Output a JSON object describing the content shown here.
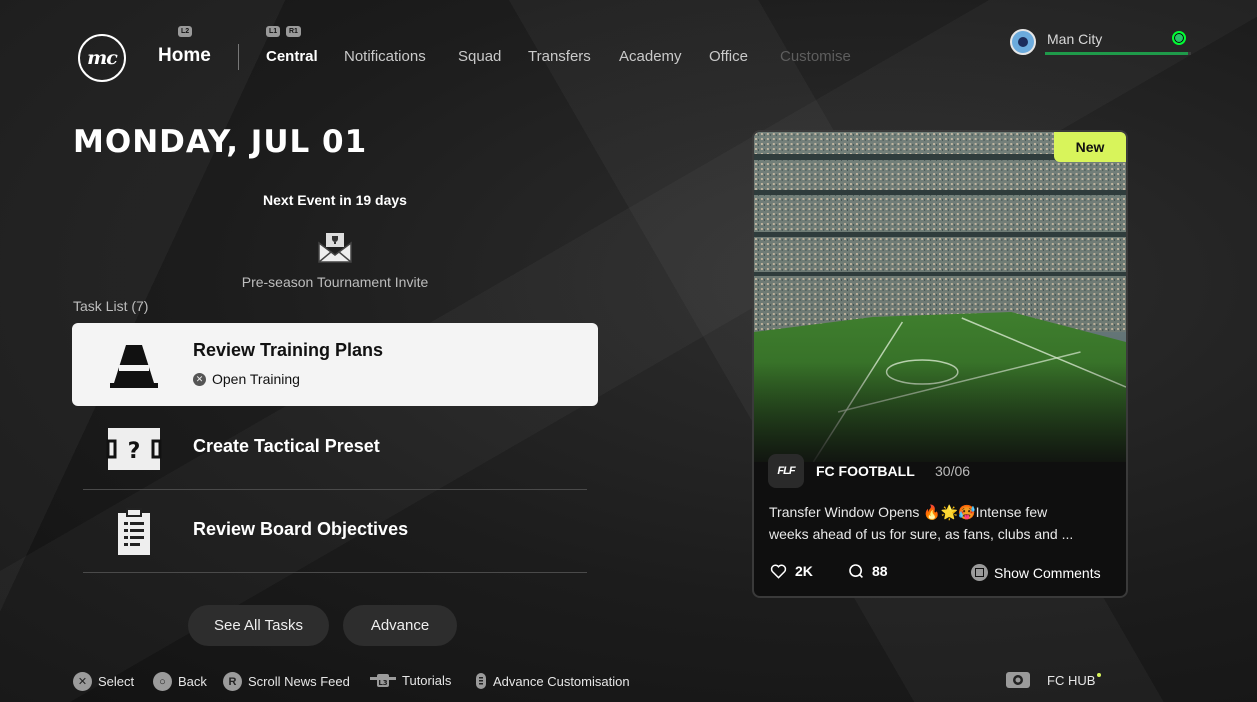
{
  "header": {
    "logo_text": "mc",
    "home_label": "Home",
    "home_bumper": "L2",
    "tabs_bumpers": [
      "L1",
      "R1"
    ],
    "tabs": [
      {
        "label": "Central",
        "state": "active"
      },
      {
        "label": "Notifications",
        "state": "normal"
      },
      {
        "label": "Squad",
        "state": "normal"
      },
      {
        "label": "Transfers",
        "state": "normal"
      },
      {
        "label": "Academy",
        "state": "normal"
      },
      {
        "label": "Office",
        "state": "normal"
      },
      {
        "label": "Customise",
        "state": "disabled"
      }
    ],
    "club": {
      "name": "Man City",
      "progress": 0.98,
      "accent": "#1f9a4a"
    }
  },
  "main": {
    "date": "MONDAY, JUL 01",
    "next_event": "Next Event in 19 days",
    "event_name": "Pre-season Tournament Invite",
    "task_list_label": "Task List (7)",
    "tasks": [
      {
        "title": "Review Training Plans",
        "subtitle": "Open Training",
        "icon": "training-cone-icon",
        "selected": true
      },
      {
        "title": "Create Tactical Preset",
        "icon": "tactics-board-icon",
        "selected": false
      },
      {
        "title": "Review Board Objectives",
        "icon": "clipboard-icon",
        "selected": false
      }
    ],
    "buttons": {
      "see_all": "See All Tasks",
      "advance": "Advance"
    }
  },
  "news": {
    "badge": "New",
    "source_logo": "FLF",
    "source": "FC FOOTBALL",
    "date": "30/06",
    "body_line1": "Transfer Window Opens 🔥🌟🥵Intense few",
    "body_line2": "weeks ahead of us for sure, as fans, clubs and ...",
    "likes": "2K",
    "comments": "88",
    "show_comments": "Show Comments",
    "badge_color": "#d8f45b"
  },
  "footer": {
    "select": "Select",
    "back": "Back",
    "scroll": "Scroll News Feed",
    "tutorials": "Tutorials",
    "advance_customisation": "Advance Customisation",
    "fc_hub": "FC HUB",
    "tutorials_key": "L3"
  }
}
